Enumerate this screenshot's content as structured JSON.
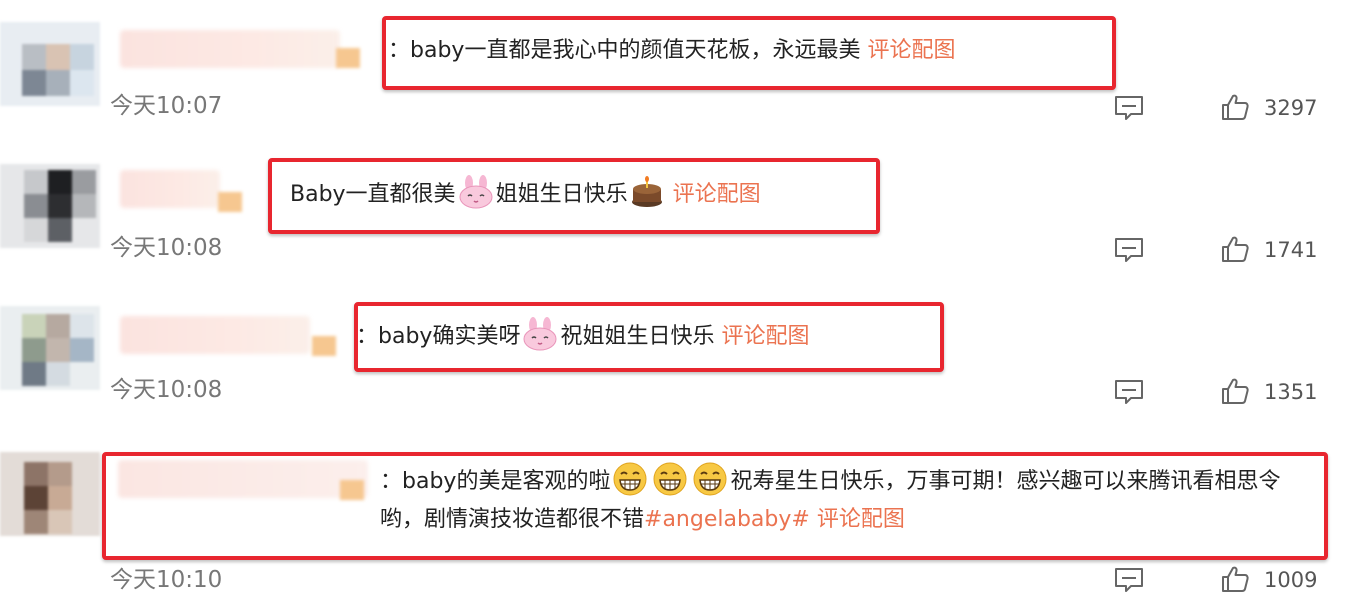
{
  "comments": [
    {
      "prefix": "：",
      "text": "baby一直都是我心中的颜值天花板，永远最美 ",
      "link": "评论配图",
      "time": "今天10:07",
      "likes": "3297"
    },
    {
      "text_a": "Baby一直都很美",
      "text_b": "姐姐生日快乐",
      "link": "评论配图",
      "time": "今天10:08",
      "likes": "1741"
    },
    {
      "prefix": "：",
      "text_a": "baby确实美呀",
      "text_b": "祝姐姐生日快乐 ",
      "link": "评论配图",
      "time": "今天10:08",
      "likes": "1351"
    },
    {
      "prefix": "：",
      "text_a": "baby的美是客观的啦",
      "text_b": "祝寿星生日快乐，万事可期！感兴趣可以来腾讯看相思令哟，剧情演技妆造都很不错",
      "hashtag": "#angelababy#",
      "link": " 评论配图",
      "time": "今天10:10",
      "likes": "1009"
    }
  ],
  "icons": {
    "reply": "comment-reply-icon",
    "like": "thumbs-up-icon",
    "bunny": "bunny-emoji-icon",
    "cake": "cake-emoji-icon",
    "grin": "grin-emoji-icon"
  },
  "colors": {
    "highlight_border": "#e8262f",
    "link": "#eb7350",
    "time": "#777777"
  }
}
